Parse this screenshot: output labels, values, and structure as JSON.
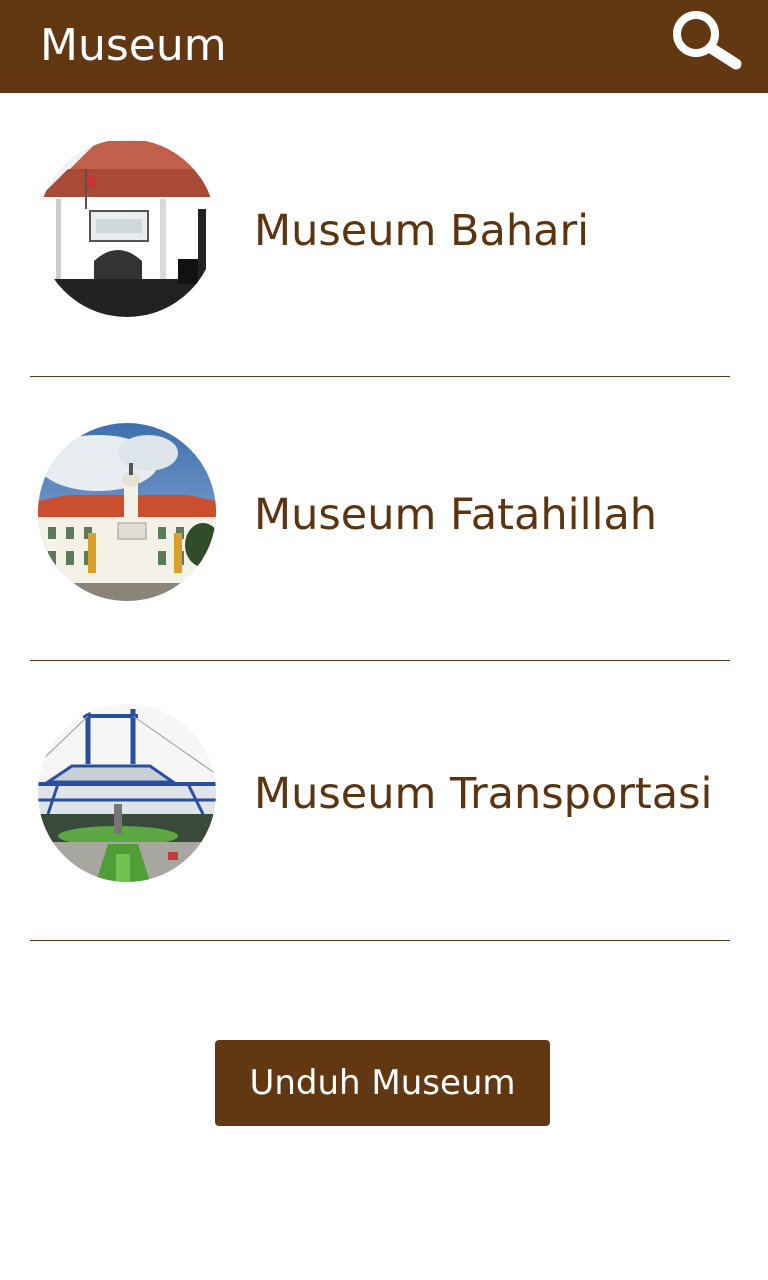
{
  "app_bar": {
    "title": "Museum",
    "search_icon": "search-icon",
    "background": "#613812"
  },
  "museums": [
    {
      "name": "Museum Bahari",
      "image": "museum-bahari-photo"
    },
    {
      "name": "Museum Fatahillah",
      "image": "museum-fatahillah-photo"
    },
    {
      "name": "Museum Transportasi",
      "image": "museum-transportasi-photo"
    }
  ],
  "download_button": {
    "label": "Unduh Museum"
  },
  "colors": {
    "primary": "#613812",
    "label_text": "#5c3510",
    "divider": "#5a3a1a"
  }
}
